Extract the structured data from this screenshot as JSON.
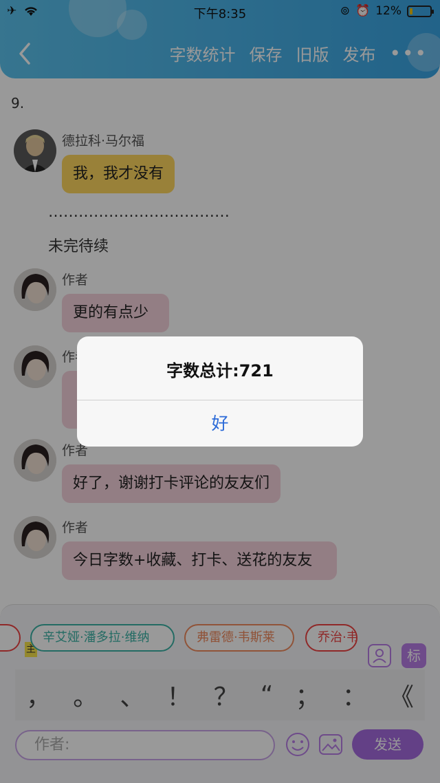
{
  "status_bar": {
    "time": "下午8:35",
    "battery_percent": "12%",
    "battery_level": 0.12
  },
  "nav": {
    "actions": [
      "字数统计",
      "保存",
      "旧版",
      "发布"
    ],
    "more": "•••"
  },
  "chat": {
    "chapter_number": "9.",
    "messages": [
      {
        "sender": "德拉科·马尔福",
        "text": "我，我才没有",
        "bubble_color": "#ffd760"
      },
      {
        "sender": "作者",
        "text": "更的有点少",
        "bubble_color": "#f6d2dc"
      },
      {
        "sender": "作者",
        "text": "",
        "bubble_color": "#f6d2dc"
      },
      {
        "sender": "作者",
        "text": "好了，谢谢打卡评论的友友们",
        "bubble_color": "#f6d2dc"
      },
      {
        "sender": "作者",
        "text": "今日字数+收藏、打卡、送花的友友",
        "bubble_color": "#f6d2dc"
      }
    ],
    "narration": [
      "………………………………",
      "未完待续"
    ]
  },
  "composer": {
    "host_badge": "主",
    "characters": [
      "辛艾娅·潘多拉·维纳",
      "弗雷德·韦斯莱",
      "乔治·韦"
    ],
    "tag_button": "标",
    "punctuation": [
      "，",
      "。",
      "、",
      "！",
      "？",
      "“",
      "；",
      "：",
      "《"
    ],
    "input_placeholder": "作者:",
    "send_label": "发送"
  },
  "dialog": {
    "title": "字数总计:721",
    "confirm_label": "好"
  },
  "colors": {
    "header_blue": "#3aa5e4",
    "accent_purple": "#a66be0",
    "pink_bubble": "#f6d2dc",
    "yellow_bubble": "#ffd760",
    "dialog_button": "#2c6bd8"
  }
}
